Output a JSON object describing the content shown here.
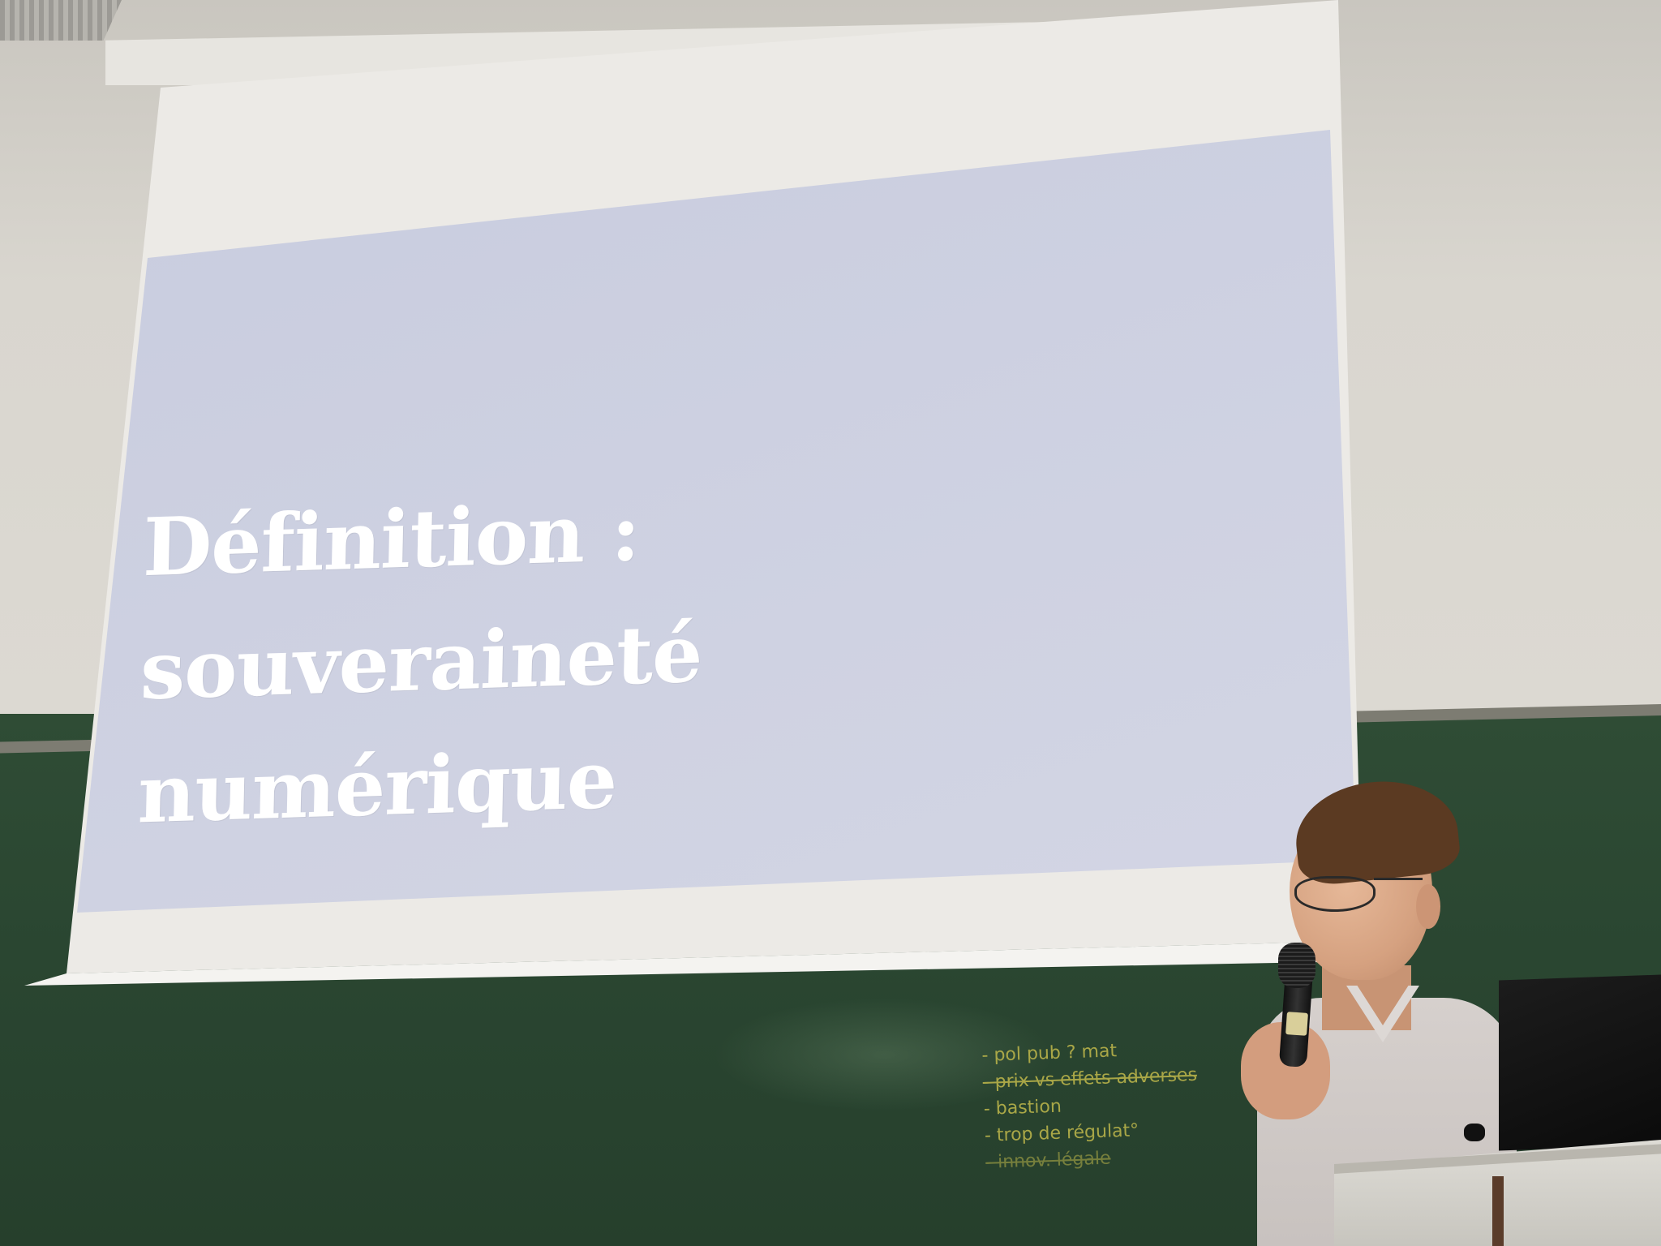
{
  "slide": {
    "title_lines": [
      "Définition :",
      "souveraineté",
      "numérique"
    ]
  },
  "chalkboard": {
    "notes": [
      "- pol pub ? mat",
      "- prix vs effets adverses",
      "- bastion",
      "- trop de régulat°",
      "- innov. légale"
    ]
  },
  "colors": {
    "slide_background": "#cbcee0",
    "slide_text": "#ffffff",
    "chalkboard": "#2c4932",
    "wall": "#d9d6cf",
    "chalk": "#b8b24a"
  }
}
